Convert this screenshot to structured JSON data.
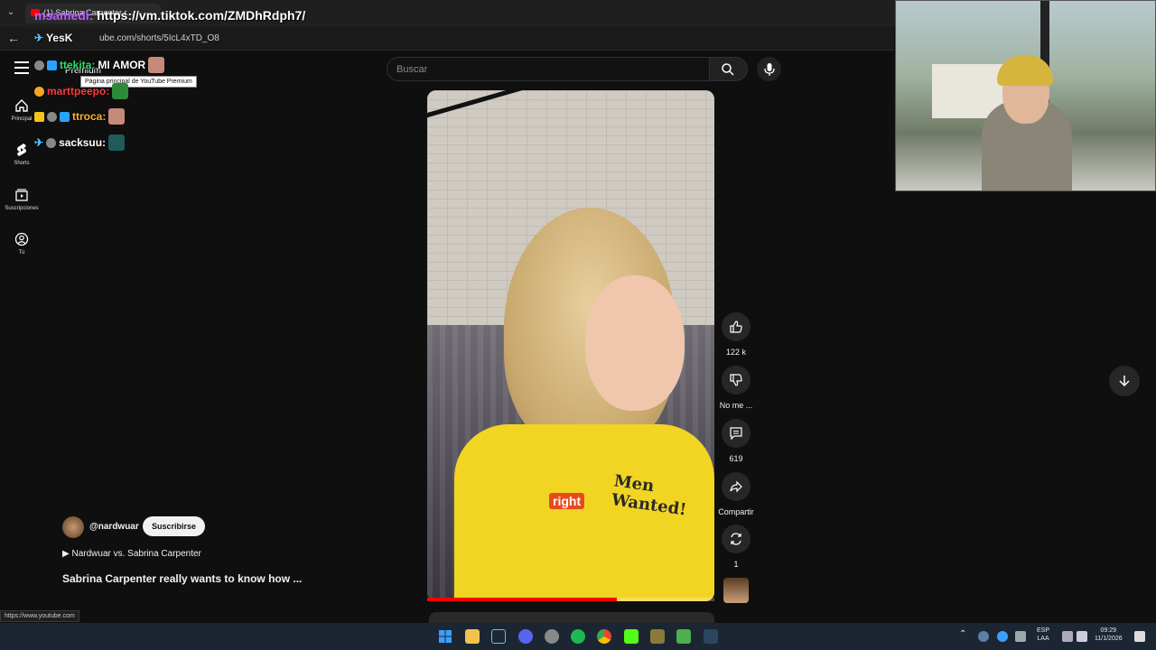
{
  "browser": {
    "tab_title": "(1) Sabrina Carpenter r...",
    "url": "ube.com/shorts/5IcL4xTD_O8",
    "status_url": "https://www.youtube.com"
  },
  "overlay": {
    "url_user": "msamedi:",
    "url_text": "https://vm.tiktok.com/ZMDhRdph7/",
    "yes_user": "YesK",
    "chat": [
      {
        "user": "ttekita:",
        "message": "MI AMOR",
        "color": "#2ee06b"
      },
      {
        "user": "marttpeepo:",
        "message": "",
        "color": "#ff3b3b"
      },
      {
        "user": "ttroca:",
        "message": "",
        "color": "#ffb02e"
      },
      {
        "user": "sacksuu:",
        "message": "",
        "color": "#ffffff"
      }
    ],
    "premium_label": "Premium",
    "tooltip": "Página principal de YouTube Premium"
  },
  "sidebar": {
    "items": [
      {
        "label": "Principal",
        "icon": "home-icon"
      },
      {
        "label": "Shorts",
        "icon": "shorts-icon"
      },
      {
        "label": "Suscripciones",
        "icon": "subscriptions-icon"
      },
      {
        "label": "Tú",
        "icon": "user-icon"
      }
    ]
  },
  "search": {
    "placeholder": "Buscar"
  },
  "video": {
    "caption": "right",
    "shirt_text": "Men Wanted!",
    "progress_fraction": 0.66
  },
  "actions": {
    "like_count": "122 k",
    "dislike_label": "No me ...",
    "comments_count": "619",
    "share_label": "Compartir",
    "remix_count": "1"
  },
  "channel": {
    "handle": "@nardwuar",
    "subscribe_label": "Suscribirse",
    "playlist": "Nardwuar vs. Sabrina Carpenter",
    "title": "Sabrina Carpenter really wants to know how ..."
  },
  "taskbar": {
    "lang": "ESP",
    "layout": "LAA",
    "time": "09:29",
    "date": "11/1/2026"
  },
  "colors": {
    "accent": "#ff0000",
    "background": "#0f0f0f"
  }
}
